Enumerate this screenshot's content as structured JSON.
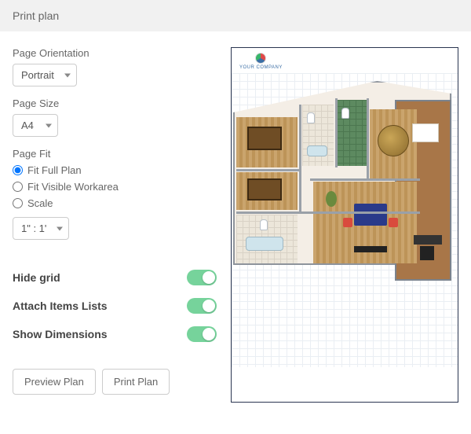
{
  "window": {
    "title": "Print plan"
  },
  "orientation": {
    "label": "Page Orientation",
    "value": "Portrait"
  },
  "page_size": {
    "label": "Page Size",
    "value": "A4"
  },
  "page_fit": {
    "label": "Page Fit",
    "options": {
      "full": "Fit Full Plan",
      "visible": "Fit Visible Workarea",
      "scale": "Scale"
    },
    "scale_value": "1\" : 1'"
  },
  "toggles": {
    "hide_grid": "Hide grid",
    "attach_items": "Attach Items Lists",
    "show_dims": "Show Dimensions"
  },
  "buttons": {
    "preview": "Preview Plan",
    "print": "Print Plan"
  },
  "preview": {
    "logo_text": "YOUR COMPANY"
  }
}
